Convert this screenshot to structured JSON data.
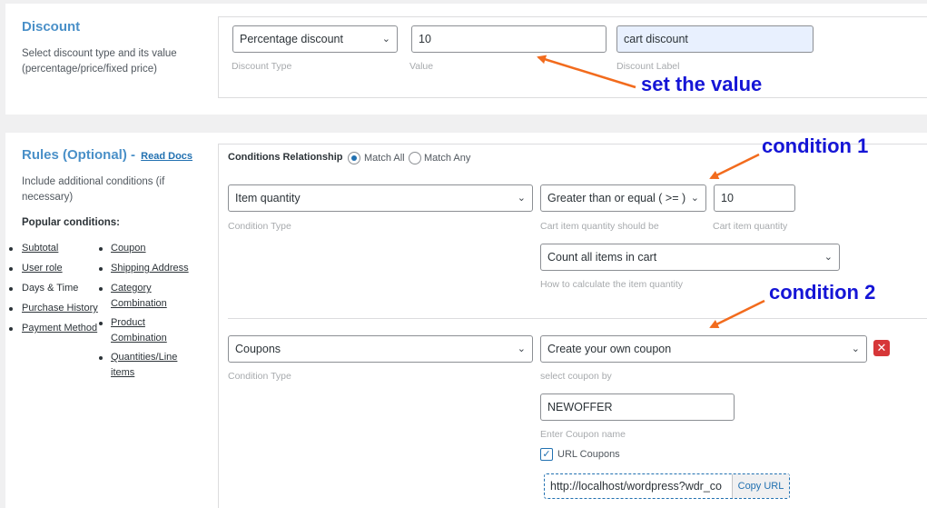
{
  "discount": {
    "title": "Discount",
    "description": "Select discount type and its value (percentage/price/fixed price)",
    "type_value": "Percentage discount",
    "type_hint": "Discount Type",
    "value": "10",
    "value_hint": "Value",
    "label_value": "cart discount",
    "label_hint": "Discount Label"
  },
  "rules": {
    "title": "Rules (Optional) -",
    "read_docs": "Read Docs",
    "description": "Include additional conditions (if necessary)",
    "popular_title": "Popular conditions:",
    "popular_col1": [
      "Subtotal",
      "User role",
      "Days & Time",
      "Purchase History",
      "Payment Method"
    ],
    "popular_col2": [
      "Coupon",
      "Shipping Address",
      "Category Combination",
      "Product Combination",
      "Quantities/Line items"
    ],
    "relationship_label": "Conditions Relationship",
    "match_all": "Match All",
    "match_any": "Match Any",
    "selected_relationship": "Match All"
  },
  "condition1": {
    "type": "Item quantity",
    "type_hint": "Condition Type",
    "operator": "Greater than or equal ( >= )",
    "operator_hint": "Cart item quantity should be",
    "quantity": "10",
    "quantity_hint": "Cart item quantity",
    "calc": "Count all items in cart",
    "calc_hint": "How to calculate the item quantity"
  },
  "condition2": {
    "type": "Coupons",
    "type_hint": "Condition Type",
    "coupon_mode": "Create your own coupon",
    "coupon_mode_hint": "select coupon by",
    "coupon_name": "NEWOFFER",
    "coupon_name_hint": "Enter Coupon name",
    "url_coupons_label": "URL Coupons",
    "url_coupons_checked": true,
    "url_value": "http://localhost/wordpress?wdr_co",
    "copy_url_label": "Copy URL"
  },
  "annotations": {
    "set_value": "set the value",
    "condition1": "condition 1",
    "condition2": "condition 2"
  },
  "colors": {
    "annotation_text": "#1515d6",
    "arrow": "#f26b1d",
    "section_title": "#4a90c8",
    "delete": "#d63638"
  }
}
